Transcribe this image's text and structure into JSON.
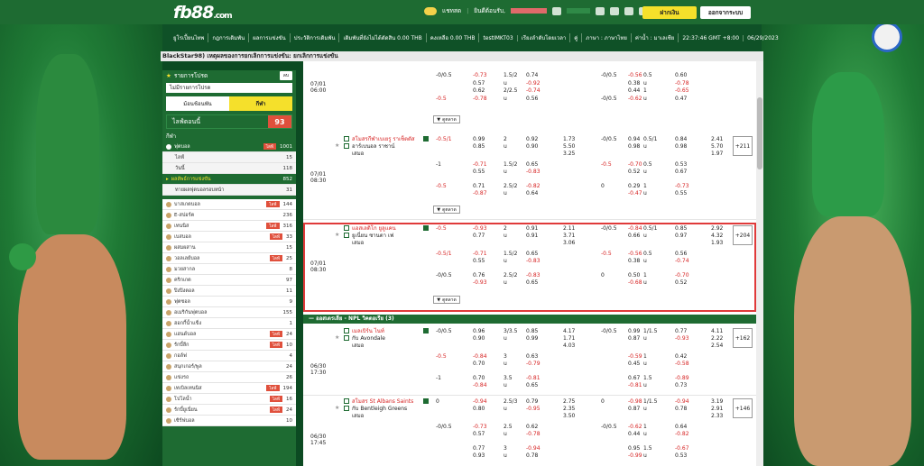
{
  "header": {
    "logo": "fb88",
    "logo_domain": ".com",
    "chat_label": "แชทสด",
    "welcome": "ยินดีต้อนรับ,",
    "deposit_btn": "ฝากเงิน",
    "logout_btn": "ออกจากระบบ"
  },
  "nav": {
    "items": [
      "ยูโรเปี้ยนไทพ",
      "กฎการเดิมพัน",
      "ผลการแข่งขัน",
      "ประวัติการเดิมพัน",
      "เดิมพันที่ยังไม่ได้ตัดสิน 0.00 THB",
      "คงเหลือ 0.00 THB",
      "testIMKT03"
    ],
    "right": [
      "เรียงลำดับโดยเวลา",
      "คู่",
      "ภาษา : ภาษาไทย",
      "ค่าน้ำ : มาเลเซีย",
      "22:37:46 GMT +8:00",
      "06/29/2023"
    ]
  },
  "title_bar": "BlackStar98) เหตุผลของการยกเลิกการแข่งขัน: ยกเลิกการแข่งขัน",
  "sidebar": {
    "header": "รายการโปรด",
    "header_btn": "ลบ",
    "promo": "ไม่มีรายการโปรด",
    "tab_off": "ม้อนช้อนพัน",
    "tab_on": "กีฬา",
    "live_label": "ไลฟ์ตอนนี้",
    "live_count": "93",
    "section": "กีฬา",
    "football": {
      "label": "ฟุตบอล",
      "badge": "ไลฟ์",
      "count": "1001"
    },
    "sub_items": [
      {
        "label": "ไลฟ์",
        "count": "15"
      },
      {
        "label": "วันนี้",
        "count": "118"
      }
    ],
    "highlight": {
      "label": "ผลลัพธ์การแข่งขัน",
      "count": "852"
    },
    "after_hl": {
      "label": "ทายผลฟุตบอลรอบหน้า",
      "count": "31"
    },
    "sports": [
      {
        "label": "บาสเกตบอล",
        "badge": "ไลฟ์",
        "count": "144"
      },
      {
        "label": "E-สปอร์ต",
        "badge": "",
        "count": "236"
      },
      {
        "label": "เทนนิส",
        "badge": "ไลฟ์",
        "count": "316"
      },
      {
        "label": "เบสบอล",
        "badge": "ไลฟ์",
        "count": "33"
      },
      {
        "label": "ผสมผสาน",
        "badge": "",
        "count": "15"
      },
      {
        "label": "วอลเลย์บอล",
        "badge": "ไลฟ์",
        "count": "25"
      },
      {
        "label": "มวยสากล",
        "badge": "",
        "count": "8"
      },
      {
        "label": "คริกเกต",
        "badge": "",
        "count": "97"
      },
      {
        "label": "ปิงปิงตอล",
        "badge": "",
        "count": "11"
      },
      {
        "label": "ฟุตซอล",
        "badge": "",
        "count": "9"
      },
      {
        "label": "อเมริกันฟุตบอล",
        "badge": "",
        "count": "155"
      },
      {
        "label": "ฮอกกี้น้ำแข็ง",
        "badge": "",
        "count": "1"
      },
      {
        "label": "แฮนด์บอล",
        "badge": "ไลฟ์",
        "count": "24"
      },
      {
        "label": "รักบี้ลีก",
        "badge": "ไลฟ์",
        "count": "10"
      },
      {
        "label": "กอล์ฟ",
        "badge": "",
        "count": "4"
      },
      {
        "label": "สนุกเกอร์/พูล",
        "badge": "",
        "count": "24"
      },
      {
        "label": "แข่งรถ",
        "badge": "",
        "count": "26"
      },
      {
        "label": "เทเบิลเทนนิส",
        "badge": "ไลฟ์",
        "count": "194"
      },
      {
        "label": "โปโลน้ำ",
        "badge": "ไลฟ์",
        "count": "16"
      },
      {
        "label": "รักบี้ยูเนี่ยน",
        "badge": "ไลฟ์",
        "count": "24"
      },
      {
        "label": "เซิร์ฟบอล",
        "badge": "",
        "count": "10"
      }
    ]
  },
  "main": {
    "more_label": "ดูตลาด",
    "top_block": {
      "date": "07/01",
      "time": "06:00",
      "rows": [
        [
          "-0/0.5",
          "-0.73",
          "1.5/2",
          "0.74",
          "-0/0.5",
          "-0.56",
          "0.5",
          "0.60"
        ],
        [
          "",
          "0.57",
          "u",
          "-0.92",
          "",
          "0.38",
          "u",
          "-0.78"
        ],
        [
          "",
          "0.62",
          "2/2.5",
          "-0.74",
          "",
          "0.44",
          "1",
          "-0.65"
        ],
        [
          "-0.5",
          "-0.78",
          "u",
          "0.56",
          "-0/0.5",
          "-0.62",
          "u",
          "0.47"
        ]
      ]
    },
    "match1": {
      "home": "สโมสรกีฬาเบเยรู ราเซ็ตตัส",
      "away": "อาร์เบนอล ราชาน์",
      "draw": "เสมอ",
      "date": "07/01",
      "time": "08:30",
      "plus": "+211",
      "main_line": [
        "-0.5/1",
        "0.99",
        "2",
        "0.92",
        "1.73",
        "-0/0.5",
        "0.94",
        "0.5/1",
        "0.84",
        "2.41"
      ],
      "main_line2": [
        "",
        "0.85",
        "u",
        "0.90",
        "5.50",
        "",
        "0.98",
        "u",
        "0.98",
        "5.70"
      ],
      "main_line3": [
        "",
        "",
        "",
        "",
        "3.25",
        "",
        "",
        "",
        "",
        "1.97"
      ],
      "alt": [
        [
          "-1",
          "-0.71",
          "1.5/2",
          "0.65",
          "-0.5",
          "-0.70",
          "0.5",
          "0.53"
        ],
        [
          "",
          "0.55",
          "u",
          "-0.83",
          "",
          "0.52",
          "u",
          "0.67"
        ],
        [
          "-0.5",
          "0.71",
          "2.5/2",
          "-0.82",
          "0",
          "0.29",
          "1",
          "-0.73"
        ],
        [
          "",
          "-0.87",
          "u",
          "0.64",
          "",
          "-0.47",
          "u",
          "0.55"
        ]
      ]
    },
    "match2": {
      "home": "แอสเลติโก ยูลูแคน",
      "away": "ยูเนี่ยน ซานตา เฟ",
      "draw": "เสมอ",
      "date": "07/01",
      "time": "08:30",
      "plus": "+204",
      "main_line": [
        "-0.5",
        "-0.93",
        "2",
        "0.91",
        "2.11",
        "-0/0.5",
        "-0.84",
        "0.5/1",
        "0.85",
        "2.92"
      ],
      "main_line2": [
        "",
        "0.77",
        "u",
        "0.91",
        "3.71",
        "",
        "0.66",
        "u",
        "0.97",
        "4.32"
      ],
      "main_line3": [
        "",
        "",
        "",
        "",
        "3.06",
        "",
        "",
        "",
        "",
        "1.93"
      ],
      "alt": [
        [
          "-0.5/1",
          "-0.71",
          "1.5/2",
          "0.65",
          "-0.5",
          "-0.56",
          "0.5",
          "0.56"
        ],
        [
          "",
          "0.55",
          "u",
          "-0.83",
          "",
          "0.38",
          "u",
          "-0.74"
        ],
        [
          "-0/0.5",
          "0.76",
          "2.5/2",
          "-0.83",
          "0",
          "0.50",
          "1",
          "-0.70"
        ],
        [
          "",
          "-0.93",
          "u",
          "0.65",
          "",
          "-0.68",
          "u",
          "0.52"
        ]
      ]
    },
    "league2": "ออสเตรเลีย - NPL วิคตอเรีย (3)",
    "match3": {
      "home": "เมลเบิร์น ไนท์",
      "away": "กับ Avondale",
      "draw": "เสมอ",
      "date": "06/30",
      "time": "17:30",
      "plus": "+162",
      "main_line": [
        "-0/0.5",
        "0.96",
        "3/3.5",
        "0.85",
        "4.17",
        "-0/0.5",
        "0.99",
        "1/1.5",
        "0.77",
        "4.11"
      ],
      "main_line2": [
        "",
        "0.90",
        "u",
        "0.99",
        "1.71",
        "",
        "0.87",
        "u",
        "-0.93",
        "2.22"
      ],
      "main_line3": [
        "",
        "",
        "",
        "",
        "4.03",
        "",
        "",
        "",
        "",
        "2.54"
      ],
      "alt": [
        [
          "-0.5",
          "-0.84",
          "3",
          "0.63",
          "",
          "-0.59",
          "1",
          "0.42"
        ],
        [
          "",
          "0.70",
          "u",
          "-0.79",
          "",
          "0.45",
          "u",
          "-0.58"
        ],
        [
          "-1",
          "0.70",
          "3.5",
          "-0.81",
          "",
          "0.67",
          "1.5",
          "-0.89"
        ],
        [
          "",
          "-0.84",
          "u",
          "0.65",
          "",
          "-0.81",
          "u",
          "0.73"
        ]
      ]
    },
    "match4": {
      "home": "สโมสร St Albans Saints",
      "away": "กับ Bentleigh Greens",
      "draw": "เสมอ",
      "date": "06/30",
      "time": "17:45",
      "plus": "+146",
      "main_line": [
        "0",
        "-0.94",
        "2.5/3",
        "0.79",
        "2.75",
        "0",
        "-0.98",
        "1/1.5",
        "-0.94",
        "3.19"
      ],
      "main_line2": [
        "",
        "0.80",
        "u",
        "-0.95",
        "2.35",
        "",
        "0.87",
        "u",
        "0.78",
        "2.91"
      ],
      "main_line3": [
        "",
        "",
        "",
        "",
        "3.50",
        "",
        "",
        "",
        "",
        "2.33"
      ],
      "alt": [
        [
          "-0/0.5",
          "-0.73",
          "2.5",
          "0.62",
          "-0/0.5",
          "-0.62",
          "1",
          "0.64"
        ],
        [
          "",
          "0.57",
          "u",
          "-0.78",
          "",
          "0.44",
          "u",
          "-0.82"
        ],
        [
          "",
          "0.77",
          "3",
          "-0.94",
          "",
          "0.95",
          "1.5",
          "-0.67"
        ],
        [
          "",
          "0.93",
          "u",
          "0.78",
          "",
          "-0.99",
          "u",
          "0.53"
        ]
      ]
    }
  }
}
